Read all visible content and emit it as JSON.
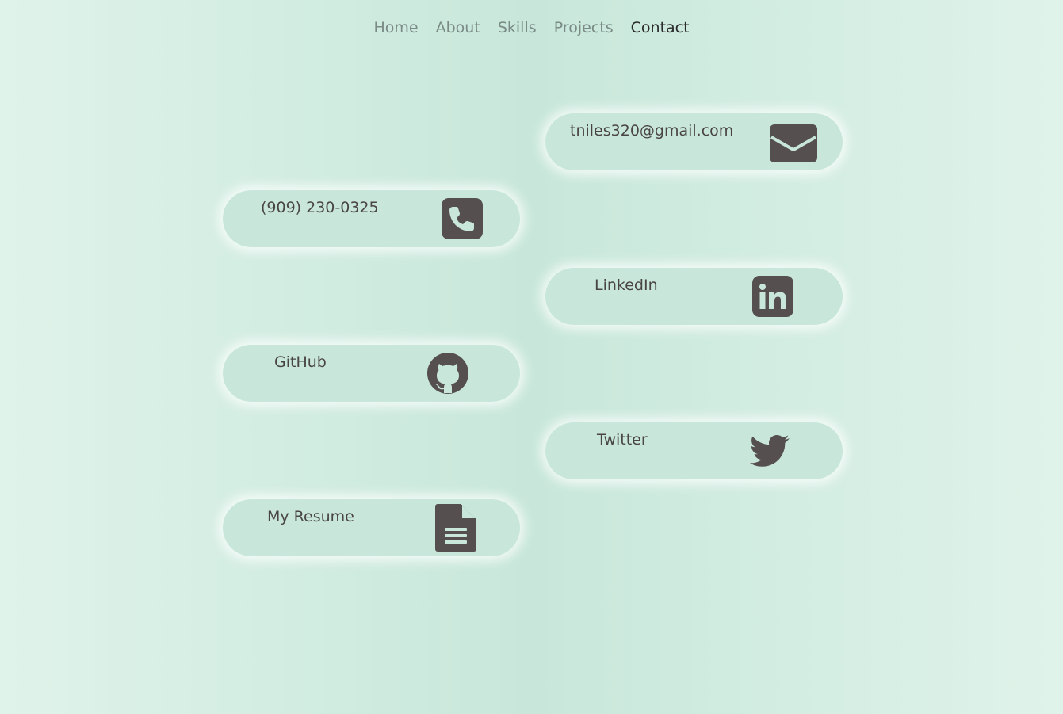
{
  "nav": {
    "items": [
      "Home",
      "About",
      "Skills",
      "Projects",
      "Contact"
    ],
    "active": "Contact"
  },
  "contacts": {
    "email": {
      "label": "tniles320@gmail.com",
      "icon": "envelope-icon"
    },
    "phone": {
      "label": "(909) 230-0325",
      "icon": "phone-icon"
    },
    "linkedin": {
      "label": "LinkedIn",
      "icon": "linkedin-icon"
    },
    "github": {
      "label": "GitHub",
      "icon": "github-icon"
    },
    "twitter": {
      "label": "Twitter",
      "icon": "twitter-icon"
    },
    "resume": {
      "label": "My Resume",
      "icon": "document-icon"
    }
  },
  "colors": {
    "card_bg": "#c8e7da",
    "icon": "#554f4f",
    "text": "#4a4545",
    "nav_text": "#7a8a85",
    "nav_active": "#2a2a2a"
  }
}
